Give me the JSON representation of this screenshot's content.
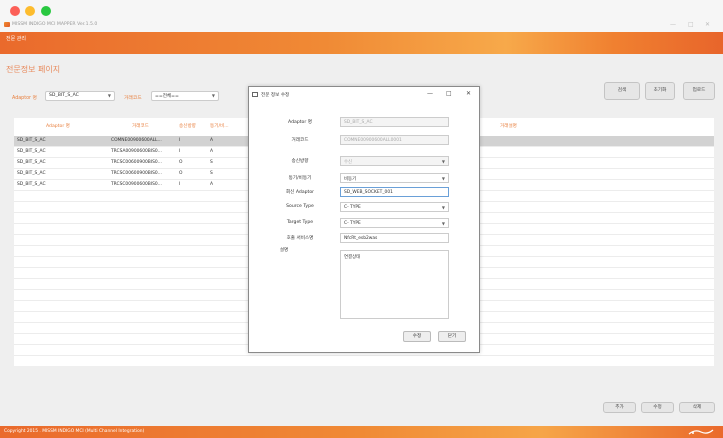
{
  "app": {
    "title": "MISSM INDIGO MCI MAPPER Ver.1.5.0",
    "win_min": "—",
    "win_max": "□",
    "win_close": "✕",
    "menu": "전문 관리"
  },
  "page": {
    "title": "전문정보 페이지",
    "filter": {
      "adaptor_label": "Adaptor 명",
      "adaptor_value": "SD_BIT_S_AC",
      "txcode_label": "거래코드",
      "txcode_value": "==전체=="
    },
    "buttons": {
      "search": "검색",
      "reset": "초기화",
      "upload": "업로드",
      "add": "추가",
      "edit": "수정",
      "delete": "삭제"
    }
  },
  "table": {
    "headers": [
      "Adaptor 명",
      "거래코드",
      "송신방향",
      "동기/비...",
      "",
      "거래설명"
    ],
    "rows": [
      [
        "SD_BIT_S_AC",
        "COMNE00900600ALL...",
        "I",
        "A",
        "",
        ""
      ],
      [
        "SD_BIT_S_AC",
        "TRCSA00900600BIS0...",
        "I",
        "A",
        "",
        ""
      ],
      [
        "SD_BIT_S_AC",
        "TRCSC00600900BIS0...",
        "O",
        "S",
        "",
        ""
      ],
      [
        "SD_BIT_S_AC",
        "TRCSC00600900BIS0...",
        "O",
        "S",
        "",
        ""
      ],
      [
        "SD_BIT_S_AC",
        "TRCSC00900600BIS0...",
        "I",
        "A",
        "",
        ""
      ]
    ]
  },
  "dialog": {
    "title": "전문 정보 수정",
    "min": "—",
    "max": "□",
    "close": "✕",
    "fields": {
      "adaptor_label": "Adaptor 명",
      "adaptor_value": "SD_BIT_S_AC",
      "txcode_label": "거래코드",
      "txcode_value": "COMNE00900600ALL0001",
      "direction_label": "송신방향",
      "direction_value": "수신",
      "sync_label": "동기/비동기",
      "sync_value": "비동기",
      "recv_label": "회신 Adaptor",
      "recv_value": "SD_WEB_SOCKET_001",
      "source_label": "Source Type",
      "source_value": "C- TYPE",
      "target_label": "Target Type",
      "target_value": "C- TYPE",
      "service_label": "호출 서비스명",
      "service_value": "NfcRt_esb2was",
      "desc_label": "설명",
      "desc_value": "연결상태"
    },
    "buttons": {
      "save": "수정",
      "close": "닫기"
    }
  },
  "status": {
    "text": "Copyright 2015 . MISSM INDIGO MCI (Multi Channel Integration)"
  }
}
